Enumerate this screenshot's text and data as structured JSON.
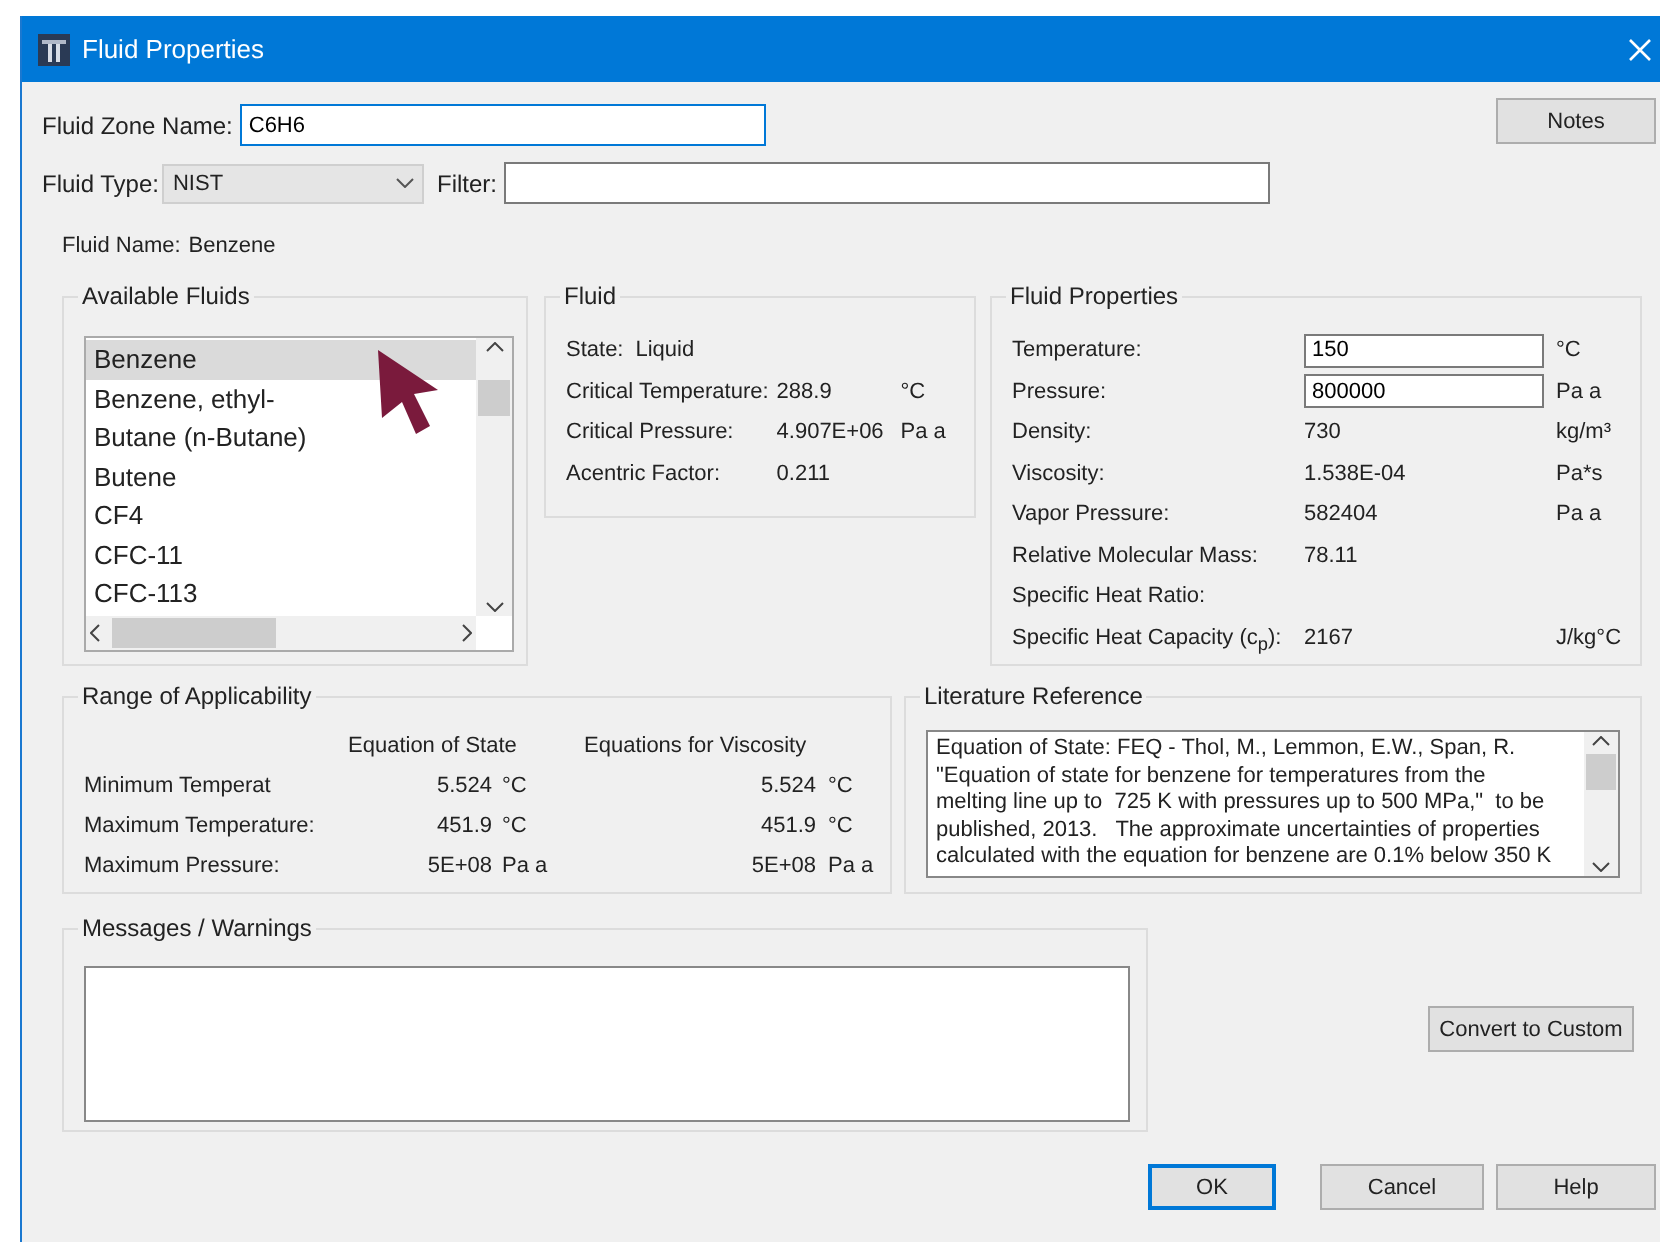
{
  "window": {
    "title": "Fluid Properties"
  },
  "fluid_zone_name": {
    "label": "Fluid Zone Name:",
    "value": "C6H6"
  },
  "notes_button": {
    "label": "Notes"
  },
  "fluid_type": {
    "label": "Fluid Type:",
    "value": "NIST"
  },
  "filter": {
    "label": "Filter:"
  },
  "fluid_name": {
    "label": "Fluid Name:",
    "value": "Benzene"
  },
  "available_fluids": {
    "title": "Available Fluids",
    "items": [
      {
        "label": "Benzene",
        "selected": true
      },
      {
        "label": "Benzene, ethyl-",
        "selected": false
      },
      {
        "label": "Butane (n-Butane)",
        "selected": false
      },
      {
        "label": "Butene",
        "selected": false
      },
      {
        "label": "CF4",
        "selected": false
      },
      {
        "label": "CFC-11",
        "selected": false
      },
      {
        "label": "CFC-113",
        "selected": false
      }
    ]
  },
  "fluid": {
    "title": "Fluid",
    "rows": [
      {
        "kind": "inline",
        "label": "State:",
        "value": "Liquid"
      },
      {
        "kind": "column",
        "label": "Critical Temperature:",
        "value": "288.9",
        "unit": "°C"
      },
      {
        "kind": "column",
        "label": "Critical Pressure:",
        "value": "4.907E+06",
        "unit": "Pa a"
      },
      {
        "kind": "column",
        "label": "Acentric Factor:",
        "value": "0.211"
      }
    ]
  },
  "fluid_properties": {
    "title": "Fluid Properties",
    "rows": [
      {
        "kind": "input",
        "label": "Temperature:",
        "value": "150",
        "unit": "°C"
      },
      {
        "kind": "input",
        "label": "Pressure:",
        "value": "800000",
        "unit": "Pa a"
      },
      {
        "kind": "text",
        "label": "Density:",
        "value": "730",
        "unit": "kg/m³"
      },
      {
        "kind": "text",
        "label": "Viscosity:",
        "value": "1.538E-04",
        "unit": "Pa*s"
      },
      {
        "kind": "text",
        "label": "Vapor Pressure:",
        "value": "582404",
        "unit": "Pa a"
      },
      {
        "kind": "text",
        "label": "Relative Molecular Mass:",
        "value": "78.11"
      },
      {
        "kind": "text",
        "label": "Specific Heat Ratio:"
      },
      {
        "kind": "text",
        "label": "Specific Heat Capacity (c$_{p}$):",
        "value": "2167",
        "unit": "J/kg°C"
      }
    ]
  },
  "range_of_applicability": {
    "title": "Range of Applicability",
    "columns": [
      "Equation of State",
      "Equations for Viscosity"
    ],
    "rows": [
      {
        "label": "Minimum Temperat",
        "state_value": "5.524",
        "state_unit": "°C",
        "viscosity_value": "5.524",
        "viscosity_unit": "°C"
      },
      {
        "label": "Maximum Temperature:",
        "state_value": "451.9",
        "state_unit": "°C",
        "viscosity_value": "451.9",
        "viscosity_unit": "°C"
      },
      {
        "label": "Maximum Pressure:",
        "state_value": "5E+08",
        "state_unit": "Pa a",
        "viscosity_value": "5E+08",
        "viscosity_unit": "Pa a"
      }
    ]
  },
  "literature_reference": {
    "title": "Literature Reference",
    "lines": [
      "Equation of State: FEQ - Thol, M., Lemmon, E.W., Span, R.",
      "\"Equation of state for benzene for temperatures from the",
      "melting line up to  725 K with pressures up to 500 MPa,\"  to be",
      "published, 2013.   The approximate uncertainties of properties",
      "calculated with the equation for benzene are 0.1% below 350 K"
    ]
  },
  "messages": {
    "title": "Messages / Warnings"
  },
  "convert_button": {
    "label": "Convert to Custom"
  },
  "buttons": [
    {
      "label": "OK",
      "default": true
    },
    {
      "label": "Cancel",
      "default": false
    },
    {
      "label": "Help",
      "default": false
    }
  ]
}
